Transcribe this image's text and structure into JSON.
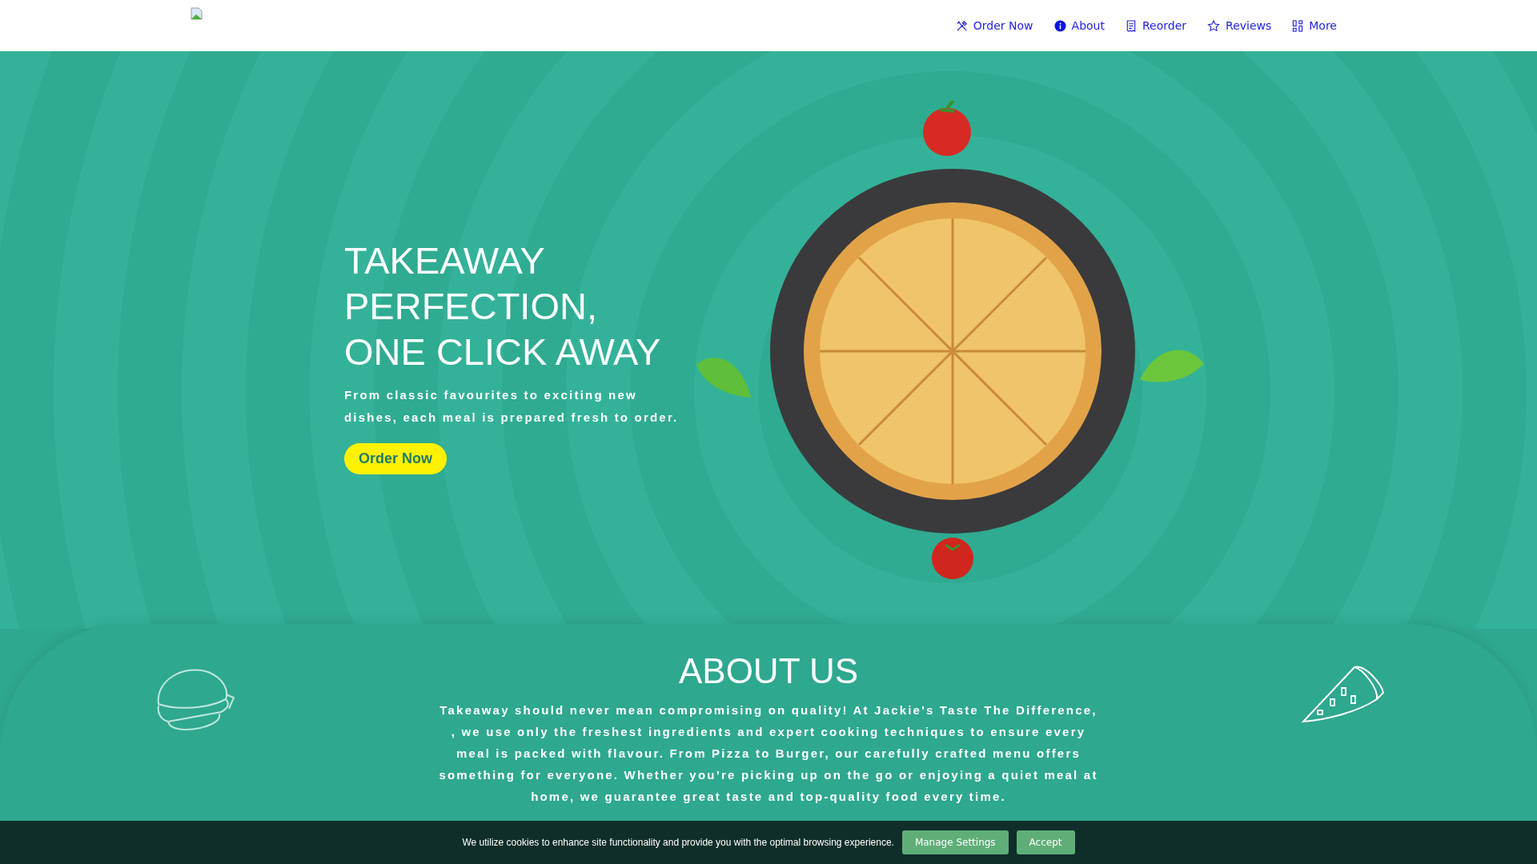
{
  "nav": {
    "items": [
      {
        "label": "Order Now",
        "kind": "utensils"
      },
      {
        "label": "About",
        "kind": "info"
      },
      {
        "label": "Reorder",
        "kind": "receipt"
      },
      {
        "label": "Reviews",
        "kind": "star"
      },
      {
        "label": "More",
        "kind": "grid"
      }
    ]
  },
  "hero": {
    "title_lines": [
      "TAKEAWAY",
      "PERFECTION,",
      "ONE CLICK AWAY"
    ],
    "text": "From classic favourites to exciting new dishes, each meal is prepared fresh to order.",
    "button": "Order Now"
  },
  "about": {
    "title": "ABOUT US",
    "text": "Takeaway should never mean compromising on quality! At Jackie's Taste The Difference, , we use only the freshest ingredients and expert cooking techniques to ensure every meal is packed with flavour. From Pizza to Burger, our carefully crafted menu offers something for everyone. Whether you’re picking up on the go or enjoying a quiet meal at home, we guarantee great taste and top-quality food every time."
  },
  "cookie_bar": {
    "text": "We utilize cookies to enhance site functionality and provide you with the optimal browsing experience.",
    "buttons": [
      "Manage Settings",
      "Accept"
    ]
  }
}
